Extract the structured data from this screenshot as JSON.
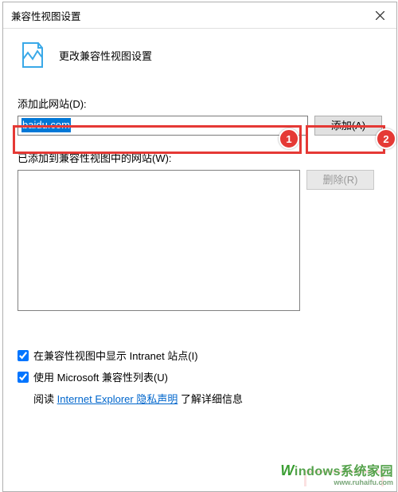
{
  "window": {
    "title": "兼容性视图设置"
  },
  "header": {
    "subtitle": "更改兼容性视图设置"
  },
  "add_section": {
    "label": "添加此网站(D):",
    "input_value": "baidu.com",
    "add_button": "添加(A)"
  },
  "list_section": {
    "label": "已添加到兼容性视图中的网站(W):",
    "remove_button": "删除(R)"
  },
  "checkboxes": {
    "intranet": {
      "label": "在兼容性视图中显示 Intranet 站点(I)",
      "checked": true
    },
    "ms_list": {
      "label": "使用 Microsoft 兼容性列表(U)",
      "checked": true
    }
  },
  "privacy_line": {
    "prefix": "阅读 ",
    "link_text": "Internet Explorer 隐私声明",
    "suffix": " 了解详细信息"
  },
  "annotations": {
    "1": "1",
    "2": "2"
  },
  "watermark": {
    "line1_w": "W",
    "line1_rest": "indows系统家园",
    "line2": "www.ruhaifu.com"
  }
}
